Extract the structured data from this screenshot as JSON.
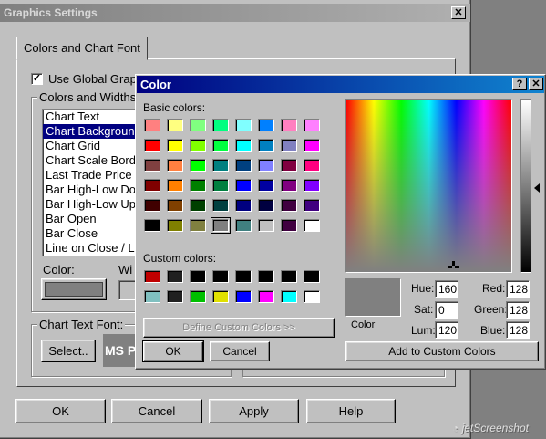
{
  "settings_window": {
    "title": "Graphics Settings",
    "tab_label": "Colors and Chart Font",
    "use_global_label": "Use Global Grap",
    "use_global_checked": true,
    "colors_widths_label": "Colors and Widths",
    "list_items": [
      "Chart Text",
      "Chart Background",
      "Chart Grid",
      "Chart Scale Bord",
      "Last Trade Price",
      "Bar High-Low Do",
      "Bar High-Low Up",
      "Bar Open",
      "Bar Close",
      "Line on Close / L"
    ],
    "selected_index": 1,
    "color_label": "Color:",
    "width_label": "Wi",
    "color_value": "#808080",
    "chart_text_font_label": "Chart Text Font:",
    "select_button": "Select..",
    "font_preview": "MS P",
    "ok": "OK",
    "cancel": "Cancel",
    "apply": "Apply",
    "help": "Help"
  },
  "color_dialog": {
    "title": "Color",
    "help_glyph": "?",
    "close_glyph": "✕",
    "basic_colors_label": "Basic colors:",
    "basic_colors": [
      [
        "#ff8080",
        "#ffff80",
        "#80ff80",
        "#00ff80",
        "#80ffff",
        "#0080ff",
        "#ff80c0",
        "#ff80ff"
      ],
      [
        "#ff0000",
        "#ffff00",
        "#80ff00",
        "#00ff40",
        "#00ffff",
        "#0080c0",
        "#8080c0",
        "#ff00ff"
      ],
      [
        "#804040",
        "#ff8040",
        "#00ff00",
        "#008080",
        "#004080",
        "#8080ff",
        "#800040",
        "#ff0080"
      ],
      [
        "#800000",
        "#ff8000",
        "#008000",
        "#008040",
        "#0000ff",
        "#0000a0",
        "#800080",
        "#8000ff"
      ],
      [
        "#400000",
        "#804000",
        "#004000",
        "#004040",
        "#000080",
        "#000040",
        "#400040",
        "#400080"
      ],
      [
        "#000000",
        "#808000",
        "#808040",
        "#808080",
        "#408080",
        "#c0c0c0",
        "#400040",
        "#ffffff"
      ]
    ],
    "selected_basic": [
      5,
      3
    ],
    "custom_colors_label": "Custom colors:",
    "custom_colors": [
      [
        "#c00000",
        "#202020",
        "#000000",
        "#000000",
        "#000000",
        "#000000",
        "#000000",
        "#000000"
      ],
      [
        "#80c0c0",
        "#202020",
        "#00c000",
        "#e0e000",
        "#0000ff",
        "#ff00ff",
        "#00ffff",
        "#ffffff"
      ]
    ],
    "define_custom_button": "Define Custom Colors >>",
    "ok": "OK",
    "cancel": "Cancel",
    "color_solid_label": "Color",
    "current_color": "#808080",
    "hue_label": "Hue:",
    "hue": "160",
    "sat_label": "Sat:",
    "sat": "0",
    "lum_label": "Lum:",
    "lum": "120",
    "red_label": "Red:",
    "red": "128",
    "green_label": "Green:",
    "green": "128",
    "blue_label": "Blue:",
    "blue": "128",
    "add_custom_button": "Add to Custom Colors"
  },
  "watermark": "jetScreenshot"
}
